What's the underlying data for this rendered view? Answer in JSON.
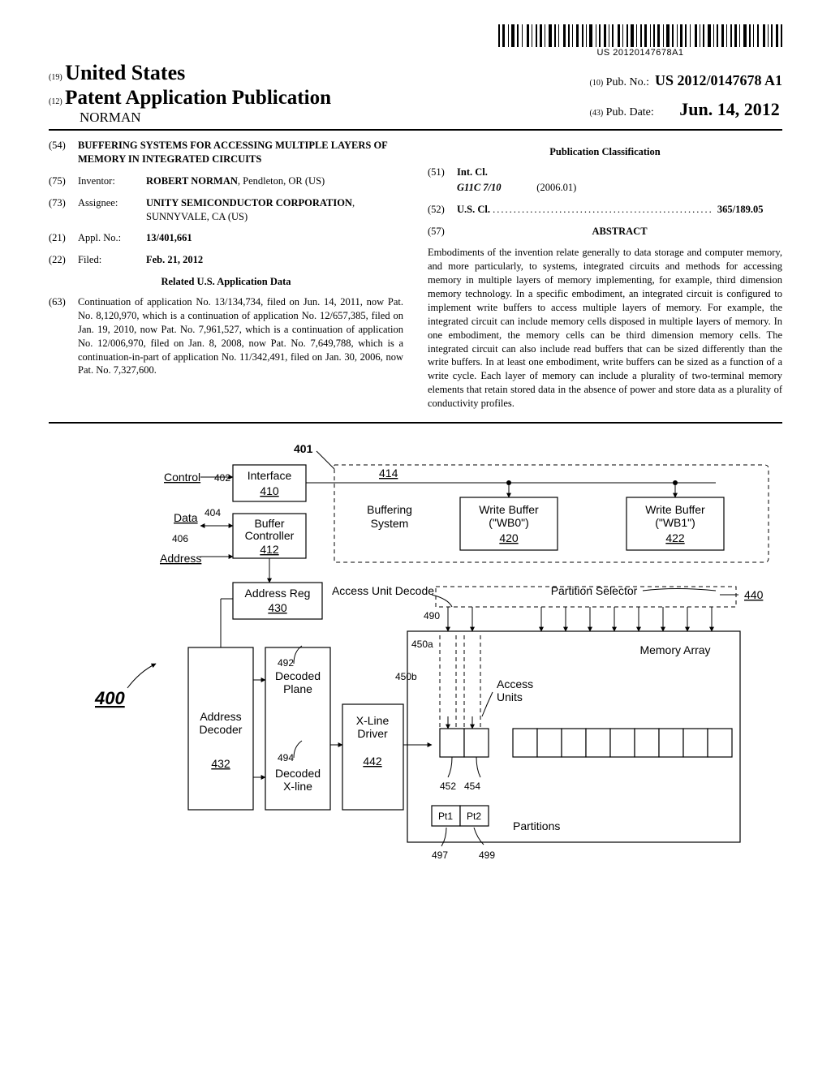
{
  "barcode_number": "US 20120147678A1",
  "header": {
    "country_code": "(19)",
    "country": "United States",
    "pub_type_code": "(12)",
    "pub_type": "Patent Application Publication",
    "author_line": "NORMAN",
    "pubno_code": "(10)",
    "pubno_label": "Pub. No.:",
    "pubno": "US 2012/0147678 A1",
    "pubdate_code": "(43)",
    "pubdate_label": "Pub. Date:",
    "pubdate": "Jun. 14, 2012"
  },
  "left": {
    "title_code": "(54)",
    "title": "BUFFERING SYSTEMS FOR ACCESSING MULTIPLE LAYERS OF MEMORY IN INTEGRATED CIRCUITS",
    "inventor_code": "(75)",
    "inventor_label": "Inventor:",
    "inventor_name": "ROBERT NORMAN",
    "inventor_loc": ", Pendleton, OR (US)",
    "assignee_code": "(73)",
    "assignee_label": "Assignee:",
    "assignee_name": "UNITY SEMICONDUCTOR CORPORATION",
    "assignee_loc": ", SUNNYVALE, CA (US)",
    "applno_code": "(21)",
    "applno_label": "Appl. No.:",
    "applno": "13/401,661",
    "filed_code": "(22)",
    "filed_label": "Filed:",
    "filed": "Feb. 21, 2012",
    "related_heading": "Related U.S. Application Data",
    "related_code": "(63)",
    "related_text": "Continuation of application No. 13/134,734, filed on Jun. 14, 2011, now Pat. No. 8,120,970, which is a continuation of application No. 12/657,385, filed on Jan. 19, 2010, now Pat. No. 7,961,527, which is a continuation of application No. 12/006,970, filed on Jan. 8, 2008, now Pat. No. 7,649,788, which is a continuation-in-part of application No. 11/342,491, filed on Jan. 30, 2006, now Pat. No. 7,327,600."
  },
  "right": {
    "pub_class_heading": "Publication Classification",
    "intcl_code": "(51)",
    "intcl_label": "Int. Cl.",
    "intcl_code_val": "G11C 7/10",
    "intcl_date": "(2006.01)",
    "uscl_code": "(52)",
    "uscl_label": "U.S. Cl.",
    "uscl_val": "365/189.05",
    "abstract_code": "(57)",
    "abstract_label": "ABSTRACT",
    "abstract_text": "Embodiments of the invention relate generally to data storage and computer memory, and more particularly, to systems, integrated circuits and methods for accessing memory in multiple layers of memory implementing, for example, third dimension memory technology. In a specific embodiment, an integrated circuit is configured to implement write buffers to access multiple layers of memory. For example, the integrated circuit can include memory cells disposed in multiple layers of memory. In one embodiment, the memory cells can be third dimension memory cells. The integrated circuit can also include read buffers that can be sized differently than the write buffers. In at least one embodiment, write buffers can be sized as a function of a write cycle. Each layer of memory can include a plurality of two-terminal memory elements that retain stored data in the absence of power and store data as a plurality of conductivity profiles."
  },
  "figure": {
    "ref_main": "400",
    "ref_401": "401",
    "ref_402": "402",
    "ref_404": "404",
    "ref_406": "406",
    "ref_410": "410",
    "ref_412": "412",
    "ref_414": "414",
    "ref_420": "420",
    "ref_422": "422",
    "ref_430": "430",
    "ref_432": "432",
    "ref_440": "440",
    "ref_442": "442",
    "ref_450a": "450a",
    "ref_450b": "450b",
    "ref_452": "452",
    "ref_454": "454",
    "ref_490": "490",
    "ref_492": "492",
    "ref_494": "494",
    "ref_497": "497",
    "ref_499": "499",
    "label_control": "Control",
    "label_data": "Data",
    "label_address": "Address",
    "label_interface": "Interface",
    "label_buffer_controller": "Buffer Controller",
    "label_buffering_system": "Buffering System",
    "label_wb0_a": "Write Buffer",
    "label_wb0_b": "(\"WB0\")",
    "label_wb1_a": "Write Buffer",
    "label_wb1_b": "(\"WB1\")",
    "label_address_reg": "Address Reg",
    "label_access_unit_decode": "Access Unit Decode",
    "label_partition_selector": "Partition Selector",
    "label_address_decoder": "Address Decoder",
    "label_decoded_plane": "Decoded Plane",
    "label_decoded_xline": "Decoded X-line",
    "label_xline_driver": "X-Line Driver",
    "label_memory_array": "Memory Array",
    "label_access_units": "Access Units",
    "label_partitions": "Partitions",
    "label_pt1": "Pt1",
    "label_pt2": "Pt2"
  }
}
